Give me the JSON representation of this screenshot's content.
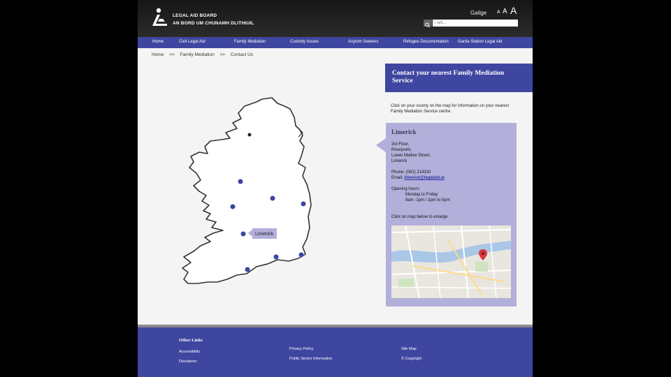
{
  "header": {
    "org_name_en": "LEGAL AID BOARD",
    "org_name_ga": "AN BORD UM CHUNAMH DLITHIUIL",
    "language_link": "Gailge",
    "font_sizes": [
      "A",
      "A",
      "A"
    ],
    "search_placeholder": "I am..."
  },
  "nav": [
    "Home",
    "Civil Legal Aid",
    "Family Mediation",
    "Custody Issues",
    "Asylum Seekers",
    "Refugee Documentation",
    "Garda Station Legal Aid"
  ],
  "breadcrumb": [
    "Home",
    ">>",
    "Family Mediation",
    ">>",
    "Contact Us"
  ],
  "map": {
    "selected_label": "Limerick",
    "marker_colors": {
      "default": "#3d44a0",
      "north": "#222222"
    }
  },
  "panel": {
    "title": "Contact your nearest Family Mediation Service",
    "intro": "Click on your county on the map for information on your nearest Family Mediation Service centre.",
    "county": "Limerick",
    "address": [
      "3rd Floor,",
      "Riverpoint,",
      "Lower Mallow Street,",
      "Limerick"
    ],
    "phone": "Phone: (061) 214310",
    "email_prefix": "Email: ",
    "email": "limerick@legalaid.ie",
    "hours_label": "Opening hours:",
    "hours": [
      "Monday to Friday",
      "9am -1pm / 2pm to 5pm"
    ],
    "enlarge_note": "Click on map below to enlarge."
  },
  "footer": {
    "heading": "Other Links",
    "col1": [
      "Accessibility",
      "Disclaimer"
    ],
    "col2": [
      "Privacy Policy",
      "Public Sector Information"
    ],
    "col3": [
      "Site Map",
      "© Copyright"
    ]
  },
  "colors": {
    "brand_blue": "#3f46a0",
    "panel_lavender": "#b2afda",
    "header_dark": "#1c1c1c"
  }
}
